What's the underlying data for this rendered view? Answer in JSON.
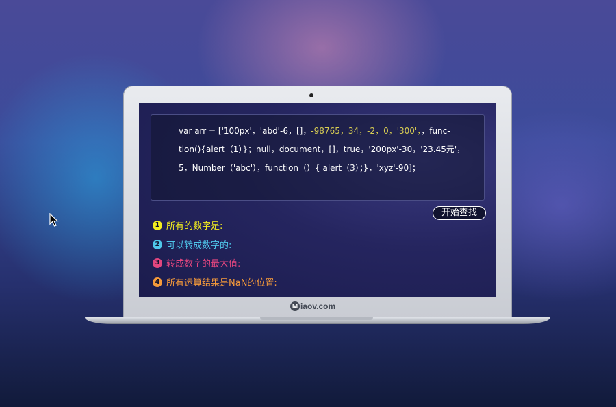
{
  "code": {
    "line1": {
      "a": "var arr = ['100px'，'abd'-6，[]，",
      "b": "-98765，34，-2，0，'300'，",
      "c": "，func-"
    },
    "line2": "tion(){alert（1）}；null，document，[]，true，'200px'-30，'23.45元'，",
    "line3": "5，Number（'abc'），function（）{ alert（3）；}，'xyz'-90]；"
  },
  "start_button": "开始查找",
  "questions": [
    {
      "num": "1",
      "text": "所有的数字是:",
      "color": "#f2ec1f"
    },
    {
      "num": "2",
      "text": "可以转成数字的:",
      "color": "#4fc6ea"
    },
    {
      "num": "3",
      "text": "转成数字的最大值:",
      "color": "#e2467f"
    },
    {
      "num": "4",
      "text": "所有运算结果是NaN的位置:",
      "color": "#f59a3a"
    }
  ],
  "brand": {
    "mark": "M",
    "text": "iaov.com"
  },
  "colors": {
    "highlight": "#d7cc53",
    "screen_bg": "#25255f"
  }
}
